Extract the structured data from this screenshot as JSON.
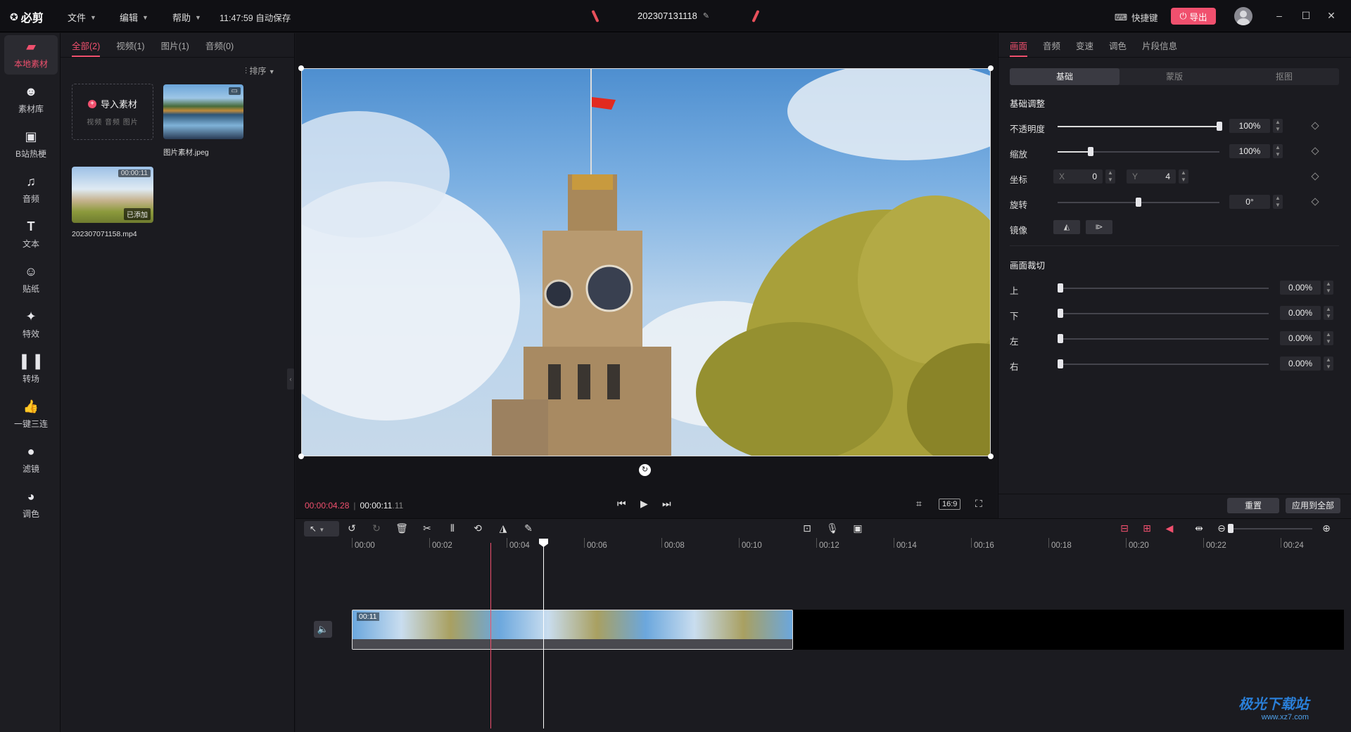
{
  "app": {
    "logo": "必剪",
    "menus": [
      "文件",
      "编辑",
      "帮助"
    ],
    "autosave": "11:47:59 自动保存",
    "project_name": "202307131118",
    "shortcut_label": "快捷键",
    "export_label": "导出"
  },
  "leftnav": [
    {
      "label": "本地素材",
      "icon": "folder-icon",
      "active": true
    },
    {
      "label": "素材库",
      "icon": "library-icon"
    },
    {
      "label": "B站热梗",
      "icon": "bilibili-icon"
    },
    {
      "label": "音频",
      "icon": "music-icon"
    },
    {
      "label": "文本",
      "icon": "text-icon"
    },
    {
      "label": "贴纸",
      "icon": "sticker-icon"
    },
    {
      "label": "特效",
      "icon": "effects-icon"
    },
    {
      "label": "转场",
      "icon": "transition-icon"
    },
    {
      "label": "一键三连",
      "icon": "like-icon"
    },
    {
      "label": "滤镜",
      "icon": "filter-icon"
    },
    {
      "label": "调色",
      "icon": "palette-icon"
    }
  ],
  "media": {
    "tabs": [
      "全部(2)",
      "视频(1)",
      "图片(1)",
      "音频(0)"
    ],
    "sort_label": "排序",
    "import_label": "导入素材",
    "import_sub": "视频 音频 图片",
    "items": [
      {
        "name": "图片素材.jpeg",
        "type": "image"
      },
      {
        "name": "202307071158.mp4",
        "duration": "00:00:11",
        "badge": "已添加",
        "type": "video"
      }
    ]
  },
  "preview": {
    "current_time": "00:00:04.28",
    "total_time_main": "00:00:11",
    "total_time_frac": ".11",
    "ratio": "16:9"
  },
  "props": {
    "tabs": [
      "画面",
      "音频",
      "变速",
      "调色",
      "片段信息"
    ],
    "segments": [
      "基础",
      "蒙版",
      "抠图"
    ],
    "basic_title": "基础调整",
    "opacity_label": "不透明度",
    "opacity_value": "100%",
    "opacity_level": 1.0,
    "scale_label": "缩放",
    "scale_value": "100%",
    "scale_level": 0.2,
    "position_label": "坐标",
    "pos_x_label": "X",
    "pos_x": "0",
    "pos_y_label": "Y",
    "pos_y": "4",
    "rotate_label": "旋转",
    "rotate_value": "0°",
    "rotate_level": 0.5,
    "mirror_label": "镜像",
    "crop_title": "画面裁切",
    "crop": [
      {
        "label": "上",
        "value": "0.00%"
      },
      {
        "label": "下",
        "value": "0.00%"
      },
      {
        "label": "左",
        "value": "0.00%"
      },
      {
        "label": "右",
        "value": "0.00%"
      }
    ],
    "reset_label": "重置",
    "apply_all_label": "应用到全部"
  },
  "timeline": {
    "ticks": [
      "00:00",
      "00:02",
      "00:04",
      "00:06",
      "00:08",
      "00:10",
      "00:12",
      "00:14",
      "00:16",
      "00:18",
      "00:20",
      "00:22",
      "00:24"
    ],
    "clip_label": "00:11"
  },
  "watermark": {
    "title": "极光下载站",
    "url": "www.xz7.com"
  }
}
